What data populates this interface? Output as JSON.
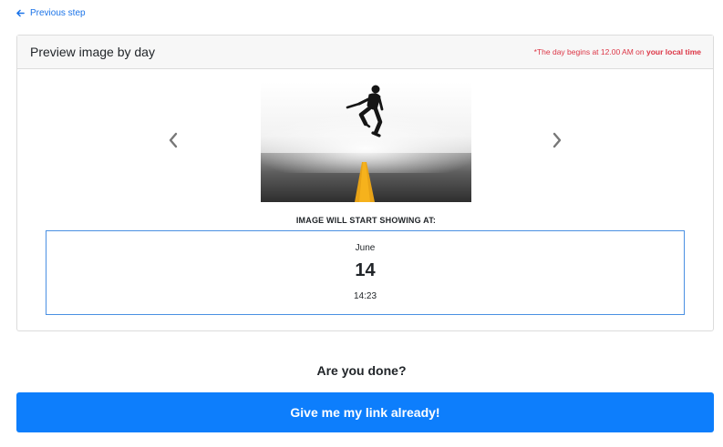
{
  "nav": {
    "back_label": "Previous step",
    "back_icon": "arrow-left-icon"
  },
  "preview": {
    "title": "Preview image by day",
    "note_prefix": "*The day begins at 12.00 AM on ",
    "note_emphasis": "your local time",
    "prev_icon": "chevron-left-icon",
    "next_icon": "chevron-right-icon",
    "start_label": "IMAGE WILL START SHOWING AT:",
    "date": {
      "month": "June",
      "day": "14",
      "time": "14:23"
    }
  },
  "footer": {
    "question": "Are you done?",
    "button_label": "Give me my link already!"
  },
  "colors": {
    "link": "#1a73e8",
    "note": "#dc3545",
    "date_box_border": "#4a90e2",
    "primary_button": "#0d7efc"
  }
}
